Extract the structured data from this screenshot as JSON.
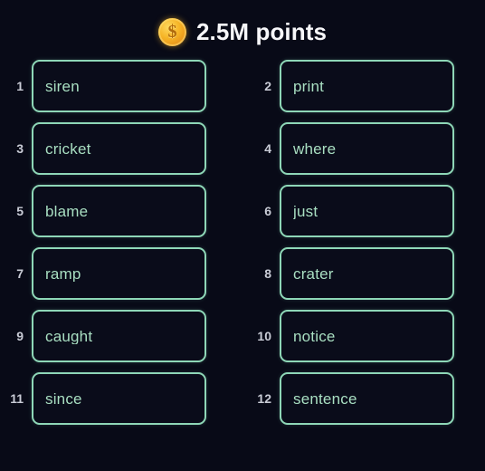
{
  "header": {
    "coin_icon": "coin-dollar-icon",
    "coin_symbol": "$",
    "points_label": "2.5M points",
    "coin_color": "#f6b426",
    "title_color": "#f7f7fa"
  },
  "theme": {
    "background": "#080a17",
    "box_background": "#0a0c1a",
    "box_border": "#8ed7b7",
    "word_text": "#a9dfc2",
    "index_text": "#c9ccd6"
  },
  "word_list": {
    "columns": 2,
    "items": [
      {
        "index": "1",
        "word": "siren"
      },
      {
        "index": "2",
        "word": "print"
      },
      {
        "index": "3",
        "word": "cricket"
      },
      {
        "index": "4",
        "word": "where"
      },
      {
        "index": "5",
        "word": "blame"
      },
      {
        "index": "6",
        "word": "just"
      },
      {
        "index": "7",
        "word": "ramp"
      },
      {
        "index": "8",
        "word": "crater"
      },
      {
        "index": "9",
        "word": "caught"
      },
      {
        "index": "10",
        "word": "notice"
      },
      {
        "index": "11",
        "word": "since"
      },
      {
        "index": "12",
        "word": "sentence"
      }
    ]
  }
}
